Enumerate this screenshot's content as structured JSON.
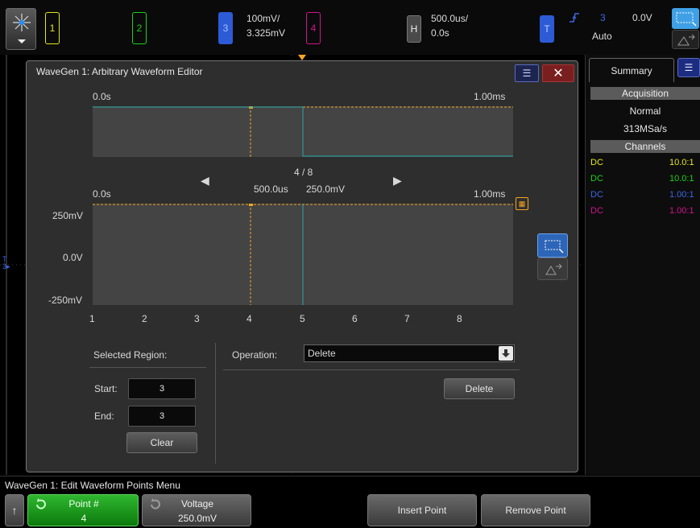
{
  "topbar": {
    "channels": [
      {
        "label": "1",
        "color": "#e5e522"
      },
      {
        "label": "2",
        "color": "#1bd11b"
      },
      {
        "label": "3",
        "color": "#2d5bd6"
      },
      {
        "label": "4",
        "color": "#d0138f"
      }
    ],
    "scale": "100mV/",
    "offset": "3.325mV",
    "horizontal_label": "H",
    "timebase": "500.0us/",
    "delay": "0.0s",
    "trigger_label": "T",
    "trigger_source": "3",
    "trigger_level": "0.0V",
    "trigger_mode": "Auto"
  },
  "editor": {
    "title": "WaveGen 1: Arbitrary Waveform Editor",
    "close_glyph": "✕",
    "menu_glyph": "☰",
    "overview": {
      "start": "0.0s",
      "end": "1.00ms"
    },
    "nav": {
      "position": "4 / 8",
      "time": "500.0us",
      "voltage": "250.0mV",
      "prev": "◀",
      "next": "▶"
    },
    "main": {
      "start": "0.0s",
      "end": "1.00ms",
      "y_labels": [
        "250mV",
        "0.0V",
        "-250mV"
      ],
      "x_ticks": [
        "1",
        "2",
        "3",
        "4",
        "5",
        "6",
        "7",
        "8"
      ]
    },
    "selected_region": {
      "title": "Selected Region:",
      "start_label": "Start:",
      "start_value": "3",
      "end_label": "End:",
      "end_value": "3",
      "clear": "Clear"
    },
    "operation": {
      "label": "Operation:",
      "value": "Delete",
      "action": "Delete"
    }
  },
  "side_panel": {
    "tab": "Summary",
    "acquisition_header": "Acquisition",
    "mode": "Normal",
    "rate": "313MSa/s",
    "channels_header": "Channels",
    "channels": [
      {
        "coupling": "DC",
        "ratio": "10.0:1",
        "color": "#e5e522"
      },
      {
        "coupling": "DC",
        "ratio": "10.0:1",
        "color": "#1bd11b"
      },
      {
        "coupling": "DC",
        "ratio": "1.00:1",
        "color": "#3a67e6"
      },
      {
        "coupling": "DC",
        "ratio": "1.00:1",
        "color": "#d0138f"
      }
    ]
  },
  "softkeys": {
    "menu_title": "WaveGen 1: Edit Waveform Points Menu",
    "back": "↑",
    "point_label": "Point #",
    "point_value": "4",
    "voltage_label": "Voltage",
    "voltage_value": "250.0mV",
    "insert": "Insert Point",
    "remove": "Remove Point"
  }
}
